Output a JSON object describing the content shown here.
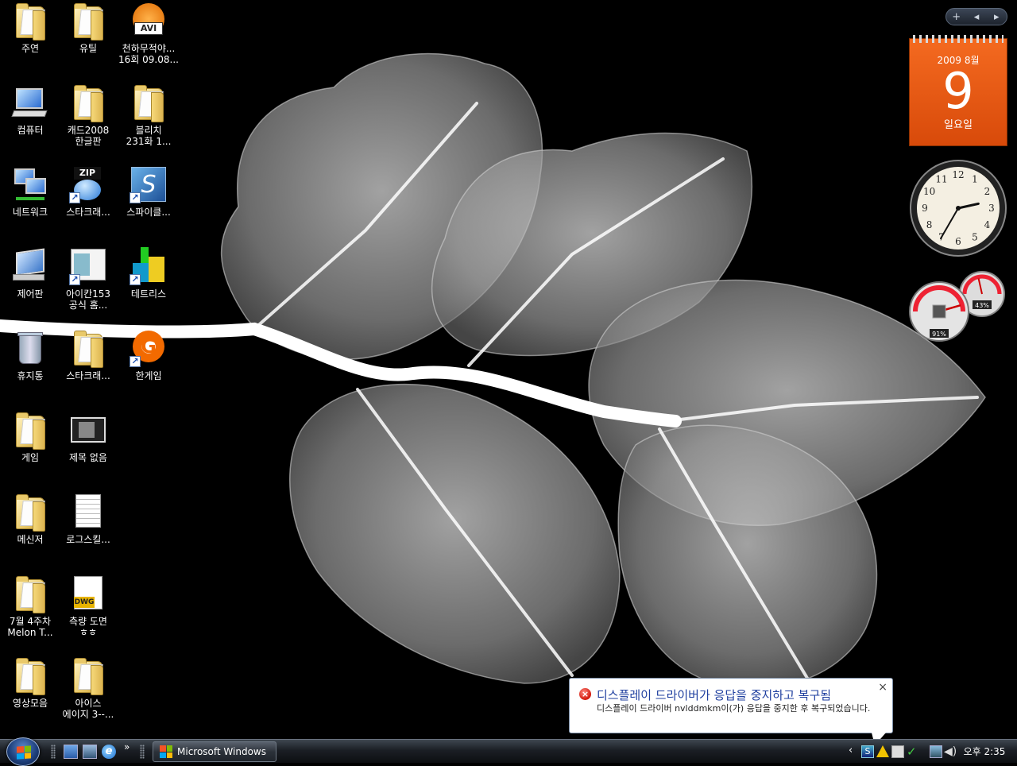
{
  "desktop": {
    "icons": [
      {
        "label": "주연",
        "type": "folder"
      },
      {
        "label": "유틸",
        "type": "folder"
      },
      {
        "label": "천하무적야...\n16회 09.08...",
        "type": "avi"
      },
      {
        "label": "컴퓨터",
        "type": "computer"
      },
      {
        "label": "캐드2008\n한글판",
        "type": "folder"
      },
      {
        "label": "블리치\n231화 1...",
        "type": "folder"
      },
      {
        "label": "네트워크",
        "type": "network"
      },
      {
        "label": "스타크래...",
        "type": "zip"
      },
      {
        "label": "스파이클...",
        "type": "spy"
      },
      {
        "label": "제어판",
        "type": "control-panel"
      },
      {
        "label": "아이칸153\n공식 홈...",
        "type": "web"
      },
      {
        "label": "테트리스",
        "type": "tetris"
      },
      {
        "label": "휴지통",
        "type": "recycle-bin"
      },
      {
        "label": "스타크래...",
        "type": "folder"
      },
      {
        "label": "한게임",
        "type": "hangame"
      },
      {
        "label": "게임",
        "type": "folder"
      },
      {
        "label": "제목 없음",
        "type": "image"
      },
      {
        "label": "메신저",
        "type": "folder"
      },
      {
        "label": "로그스킬...",
        "type": "text-file"
      },
      {
        "label": "7월 4주차\nMelon T...",
        "type": "folder"
      },
      {
        "label": "측량 도면\nㅎㅎ",
        "type": "dwg"
      },
      {
        "label": "영상모음",
        "type": "folder"
      },
      {
        "label": "아이스\n에이지 3--...",
        "type": "folder"
      }
    ]
  },
  "sidebar": {
    "controls": {
      "add": "+",
      "prev": "◂",
      "next": "▸"
    },
    "calendar": {
      "month": "2009 8월",
      "day": "9",
      "weekday": "일요일"
    },
    "clock": {
      "hour": 2,
      "minute": 35
    },
    "meter": {
      "cpu_percent": 91,
      "memory_percent": 43,
      "cpu_label": "91%",
      "memory_label": "43%"
    }
  },
  "balloon": {
    "title": "디스플레이 드라이버가 응답을 중지하고 복구됨",
    "message": "디스플레이 드라이버 nvlddmkm이(가) 응답을 중지한 후 복구되었습니다.",
    "close": "×"
  },
  "taskbar": {
    "quicklaunch_chevron": "»",
    "task_label": "Microsoft Windows",
    "tray_chevron": "‹",
    "time": "오후 2:35"
  },
  "colors": {
    "calendar": "#f46a20",
    "balloon_title": "#1f3f9f",
    "error": "#d1170b"
  }
}
